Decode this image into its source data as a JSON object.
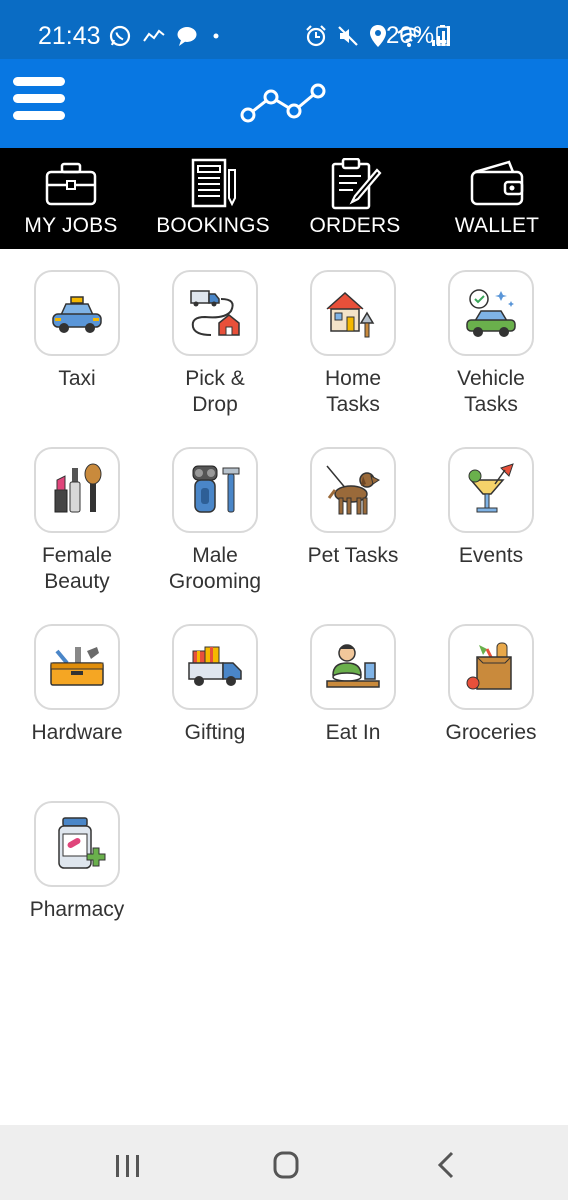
{
  "status_bar": {
    "time": "21:43",
    "battery_percent": "20%",
    "left_icons": [
      "whatsapp-icon",
      "trend-icon",
      "message-icon",
      "dot-icon"
    ],
    "right_icons": [
      "alarm-icon",
      "mute-icon",
      "location-icon",
      "wifi-icon",
      "signal-icon",
      "battery-icon"
    ]
  },
  "app_bar": {
    "menu_icon": "hamburger-icon",
    "logo_icon": "trend-line-logo"
  },
  "tabs": [
    {
      "label": "MY JOBS",
      "icon": "briefcase-icon"
    },
    {
      "label": "BOOKINGS",
      "icon": "document-icon"
    },
    {
      "label": "ORDERS",
      "icon": "clipboard-icon"
    },
    {
      "label": "WALLET",
      "icon": "wallet-icon"
    }
  ],
  "services": [
    {
      "label": "Taxi",
      "icon": "taxi-icon"
    },
    {
      "label": "Pick &\nDrop",
      "icon": "delivery-route-icon"
    },
    {
      "label": "Home\nTasks",
      "icon": "house-tools-icon"
    },
    {
      "label": "Vehicle\nTasks",
      "icon": "car-wash-icon"
    },
    {
      "label": "Female\nBeauty",
      "icon": "makeup-icon"
    },
    {
      "label": "Male\nGrooming",
      "icon": "shaver-icon"
    },
    {
      "label": "Pet Tasks",
      "icon": "dog-icon"
    },
    {
      "label": "Events",
      "icon": "cocktail-icon"
    },
    {
      "label": "Hardware",
      "icon": "toolbox-icon"
    },
    {
      "label": "Gifting",
      "icon": "gift-truck-icon"
    },
    {
      "label": "Eat In",
      "icon": "dining-icon"
    },
    {
      "label": "Groceries",
      "icon": "grocery-bag-icon"
    },
    {
      "label": "Pharmacy",
      "icon": "medicine-bottle-icon"
    }
  ],
  "nav_bar": {
    "buttons": [
      "recent-apps-icon",
      "home-icon",
      "back-icon"
    ]
  },
  "colors": {
    "status_bar": "#0a6cc4",
    "app_bar": "#0877e2",
    "tab_bar": "#000000",
    "nav_bar": "#eeeeee"
  }
}
